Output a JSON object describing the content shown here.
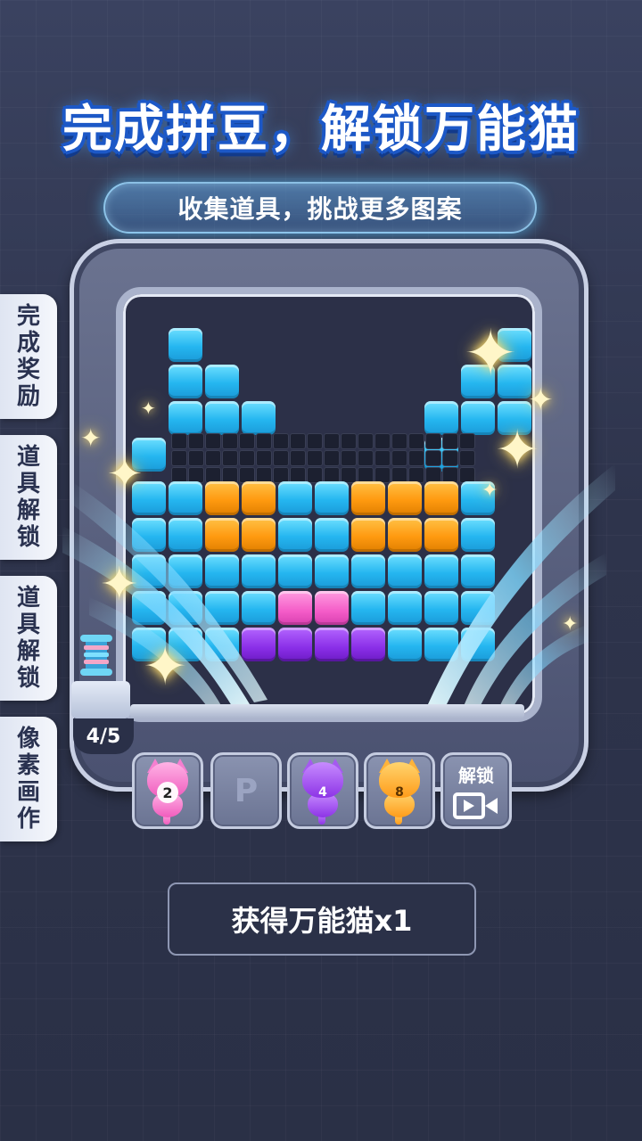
{
  "title": "完成拼豆，解锁万能猫",
  "subtitle": "收集道具，挑战更多图案",
  "side_tabs": [
    {
      "label": "完成奖励",
      "chars": [
        "完",
        "成",
        "奖",
        "励"
      ]
    },
    {
      "label": "道具解锁",
      "chars": [
        "道",
        "具",
        "解",
        "锁"
      ]
    },
    {
      "label": "道具解锁",
      "chars": [
        "道",
        "具",
        "解",
        "锁"
      ]
    },
    {
      "label": "像素画作",
      "chars": [
        "像",
        "素",
        "画",
        "作"
      ]
    }
  ],
  "progress": "4/5",
  "slots": [
    {
      "type": "cat",
      "color": "pink",
      "count": "2",
      "icon": "pink-cat-icon"
    },
    {
      "type": "placeholder",
      "label": "P",
      "icon": "parking-slot-icon"
    },
    {
      "type": "cat",
      "color": "purple",
      "count": "4",
      "icon": "purple-cat-icon"
    },
    {
      "type": "cat",
      "color": "orange",
      "count": "8",
      "icon": "orange-cat-icon"
    },
    {
      "type": "unlock",
      "label": "解锁",
      "icon": "video-icon"
    }
  ],
  "reward": "获得万能猫x1",
  "colors": {
    "accent_blue": "#25b6f0",
    "orange": "#ff9a10",
    "pink": "#f45cc8",
    "purple": "#8a2ee8",
    "background": "#2f3650"
  }
}
